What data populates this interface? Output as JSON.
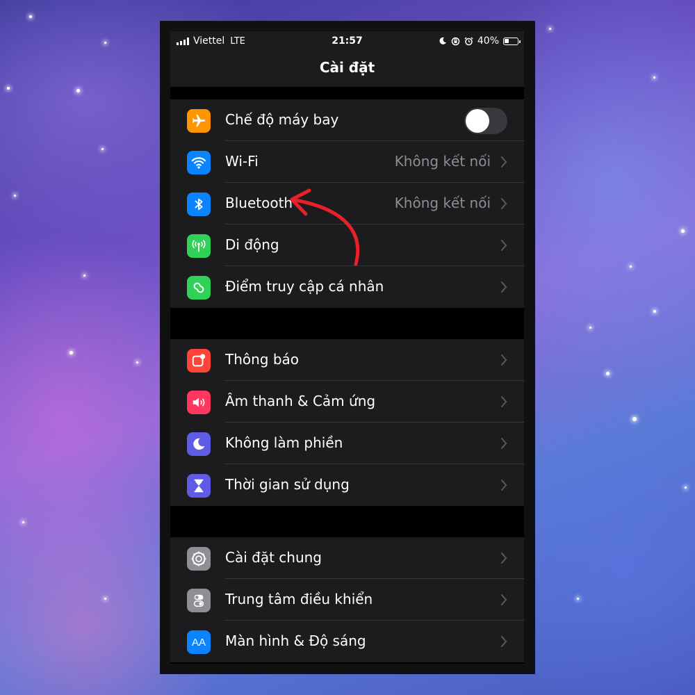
{
  "status_bar": {
    "carrier": "Viettel",
    "network": "LTE",
    "time": "21:57",
    "battery": "40%",
    "battery_level": 0.4
  },
  "header": {
    "title": "Cài đặt"
  },
  "groups": [
    {
      "items": [
        {
          "label": "Chế độ máy bay",
          "icon": "airplane-icon",
          "color": "#ff9500",
          "toggle": false
        },
        {
          "label": "Wi-Fi",
          "icon": "wifi-icon",
          "color": "#0a84ff",
          "value": "Không kết nối"
        },
        {
          "label": "Bluetooth",
          "icon": "bluetooth-icon",
          "color": "#0a84ff",
          "value": "Không kết nối"
        },
        {
          "label": "Di động",
          "icon": "cellular-icon",
          "color": "#30d158"
        },
        {
          "label": "Điểm truy cập cá nhân",
          "icon": "hotspot-icon",
          "color": "#30d158"
        }
      ]
    },
    {
      "items": [
        {
          "label": "Thông báo",
          "icon": "notifications-icon",
          "color": "#ff453a"
        },
        {
          "label": "Âm thanh & Cảm ứng",
          "icon": "sound-icon",
          "color": "#ff375f"
        },
        {
          "label": "Không làm phiền",
          "icon": "moon-icon",
          "color": "#5e5ce6"
        },
        {
          "label": "Thời gian sử dụng",
          "icon": "hourglass-icon",
          "color": "#5e5ce6"
        }
      ]
    },
    {
      "items": [
        {
          "label": "Cài đặt chung",
          "icon": "gear-icon",
          "color": "#8e8e93"
        },
        {
          "label": "Trung tâm điều khiển",
          "icon": "control-center-icon",
          "color": "#8e8e93"
        },
        {
          "label": "Màn hình & Độ sáng",
          "icon": "display-icon",
          "color": "#0a84ff",
          "icon_text": "AA"
        }
      ]
    }
  ],
  "annotation": {
    "icon": "red-arrow-icon",
    "color": "#e8202a",
    "points_to": "Bluetooth"
  }
}
